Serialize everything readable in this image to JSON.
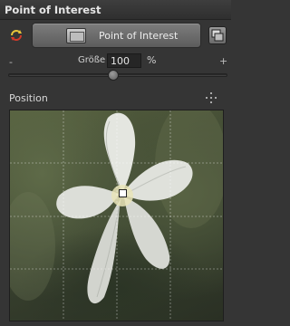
{
  "panel": {
    "title": "Point of Interest"
  },
  "mode": {
    "label": "Point of Interest"
  },
  "size": {
    "label": "Größe",
    "value": "100",
    "unit": "%",
    "min_label": "-",
    "max_label": "+",
    "level_percent": 47
  },
  "position": {
    "label": "Position"
  },
  "icons": {
    "reset": "reset-cycle-icon",
    "mode_thumb": "frame-icon",
    "view_toggle": "view-toggle-icon",
    "center": "center-target-icon"
  },
  "colors": {
    "panel_bg": "#353535",
    "reset_red": "#d23a2a",
    "reset_yellow": "#e8c43a",
    "marker": "#ffffff"
  }
}
